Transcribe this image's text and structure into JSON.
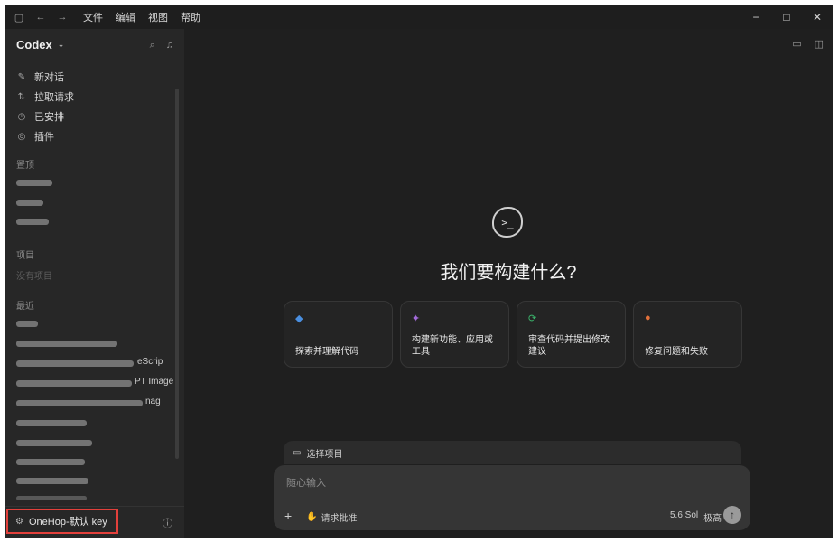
{
  "titlebar": {
    "menu": [
      "文件",
      "编辑",
      "视图",
      "帮助"
    ],
    "controls": [
      "−",
      "□",
      "✕"
    ]
  },
  "sidebar": {
    "app_name": "Codex",
    "nav": [
      {
        "icon": "edit-icon",
        "glyph": "✎",
        "label": "新对话"
      },
      {
        "icon": "pull-request-icon",
        "glyph": "⇅",
        "label": "拉取请求"
      },
      {
        "icon": "clock-icon",
        "glyph": "◷",
        "label": "已安排"
      },
      {
        "icon": "plugin-icon",
        "glyph": "◎",
        "label": "插件"
      }
    ],
    "sections": {
      "pinned": "置顶",
      "projects": "项目",
      "projects_empty": "没有项目",
      "recent": "最近"
    },
    "recent_trailing": [
      "eScrip",
      "PT Image",
      "nag"
    ],
    "account_label": "OneHop-默认 key"
  },
  "main": {
    "heading": "我们要构建什么?",
    "cards": [
      {
        "icon": "explore-icon",
        "glyph": "◆",
        "color": "#4a8fe0",
        "label": "探索并理解代码"
      },
      {
        "icon": "build-icon",
        "glyph": "✦",
        "color": "#a26ad9",
        "label": "构建新功能、应用或工具"
      },
      {
        "icon": "review-icon",
        "glyph": "⟳",
        "color": "#3bb36b",
        "label": "审查代码并提出修改建议"
      },
      {
        "icon": "bug-icon",
        "glyph": "●",
        "color": "#e2713b",
        "label": "修复问题和失败"
      }
    ],
    "project_select": "选择项目",
    "composer_placeholder": "随心输入",
    "approve_label": "请求批准",
    "model": "5.6 Sol",
    "effort": "极高"
  }
}
